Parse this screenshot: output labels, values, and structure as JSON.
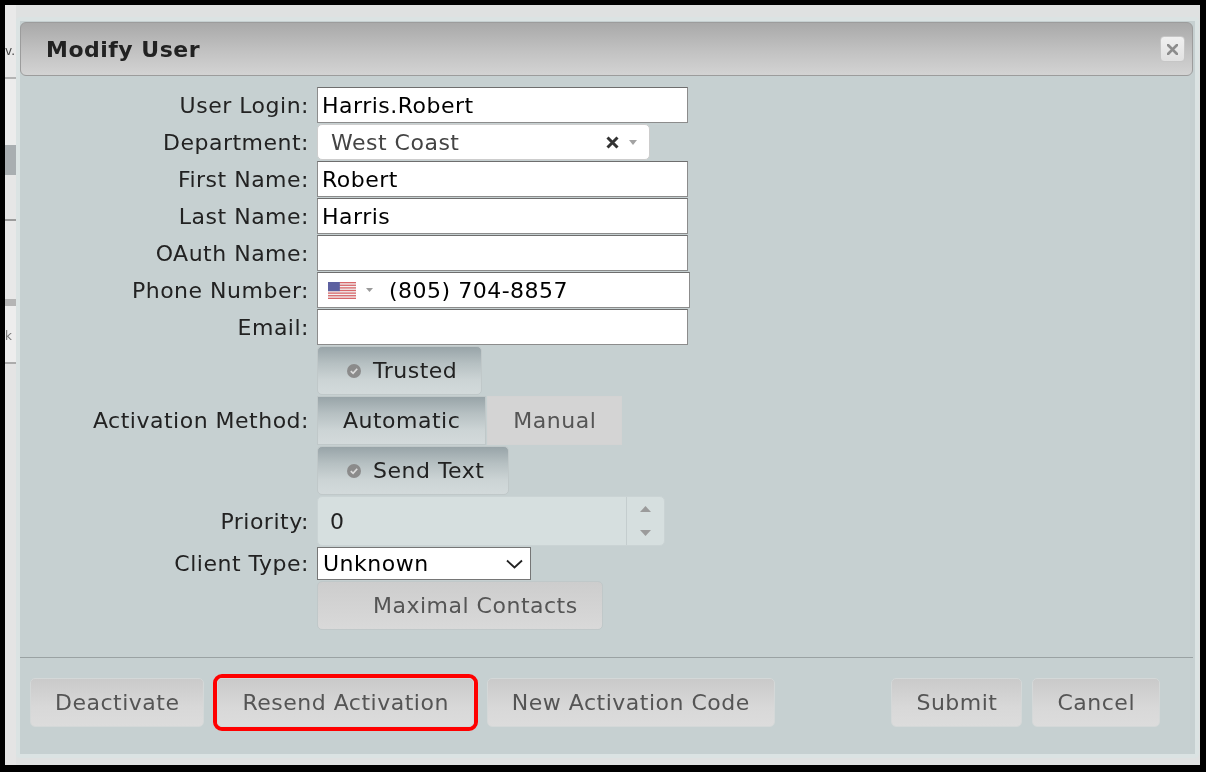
{
  "background": {
    "fragments": [
      "v.",
      "k"
    ]
  },
  "dialog": {
    "title": "Modify User"
  },
  "form": {
    "rows": [
      {
        "kind": "text",
        "label": "User Login:",
        "value": "Harris.Robert"
      },
      {
        "kind": "combo",
        "label": "Department:",
        "value": "West Coast"
      },
      {
        "kind": "text",
        "label": "First Name:",
        "value": "Robert"
      },
      {
        "kind": "text",
        "label": "Last Name:",
        "value": "Harris"
      },
      {
        "kind": "text",
        "label": "OAuth Name:"
      },
      {
        "kind": "phone",
        "label": "Phone Number:",
        "value": "(805) 704-8857"
      },
      {
        "kind": "text",
        "label": "Email:"
      },
      {
        "kind": "toggle",
        "text": "Trusted",
        "checked": true
      },
      {
        "kind": "segmented",
        "label": "Activation Method:",
        "options": [
          {
            "text": "Automatic",
            "selected": true
          },
          {
            "text": "Manual",
            "selected": false
          }
        ]
      },
      {
        "kind": "toggle",
        "text": "Send Text",
        "checked": true
      },
      {
        "kind": "spinner",
        "label": "Priority:",
        "value": "0"
      },
      {
        "kind": "select",
        "label": "Client Type:",
        "value": "Unknown"
      },
      {
        "kind": "toggle",
        "text": "Maximal Contacts",
        "checked": false
      }
    ]
  },
  "footer": {
    "left_buttons": [
      {
        "label": "Deactivate",
        "highlighted": false
      },
      {
        "label": "Resend Activation",
        "highlighted": true
      },
      {
        "label": "New Activation Code",
        "highlighted": false
      }
    ],
    "right_buttons": [
      {
        "label": "Submit",
        "highlighted": false
      },
      {
        "label": "Cancel",
        "highlighted": false
      }
    ]
  }
}
